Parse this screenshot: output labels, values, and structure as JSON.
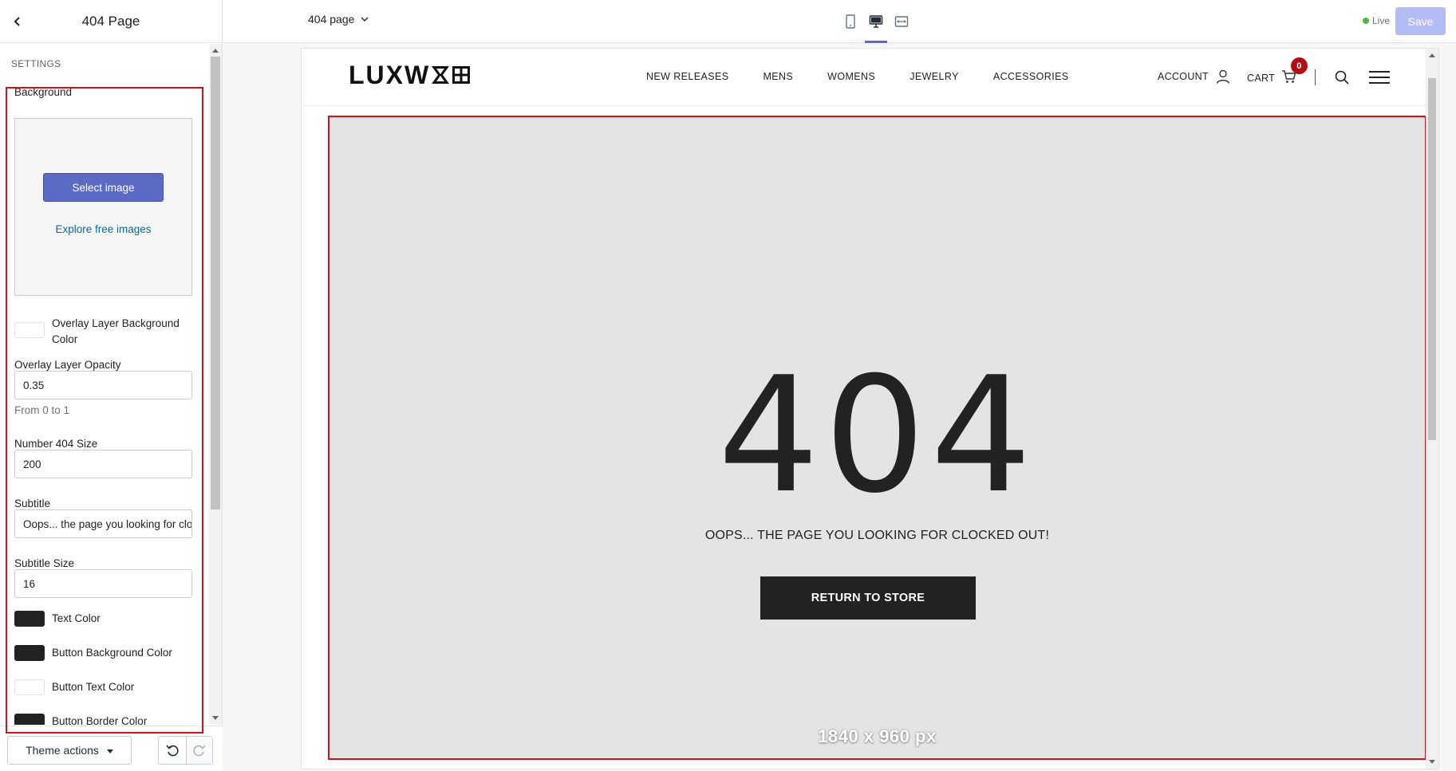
{
  "sidebar": {
    "title": "404 Page",
    "section_label": "SETTINGS",
    "background": {
      "label": "Background",
      "select_button": "Select image",
      "explore_link": "Explore free images"
    },
    "fields": {
      "overlay_color_label": "Overlay Layer Background Color",
      "overlay_color": "#ffffff",
      "opacity_label": "Overlay Layer Opacity",
      "opacity_value": "0.35",
      "opacity_hint": "From 0 to 1",
      "number_size_label": "Number 404 Size",
      "number_size_value": "200",
      "subtitle_label": "Subtitle",
      "subtitle_value": "Oops... the page you looking for clocked out!",
      "subtitle_size_label": "Subtitle Size",
      "subtitle_size_value": "16",
      "text_color_label": "Text Color",
      "text_color": "#222222",
      "button_bg_label": "Button Background Color",
      "button_bg": "#222222",
      "button_text_label": "Button Text Color",
      "button_text": "#ffffff",
      "button_border_label": "Button Border Color",
      "button_border": "#222222"
    },
    "footer": {
      "theme_actions": "Theme actions",
      "undo_icon": "undo-icon",
      "redo_icon": "redo-icon"
    }
  },
  "topbar": {
    "page_select": "404 page",
    "viewports": [
      "mobile-icon",
      "desktop-icon",
      "fullwidth-icon"
    ],
    "active_viewport": "desktop-icon",
    "live_label": "Live",
    "save_label": "Save"
  },
  "store": {
    "logo": "LUXW",
    "nav": [
      "NEW RELEASES",
      "MENS",
      "WOMENS",
      "JEWELRY",
      "ACCESSORIES"
    ],
    "account_label": "ACCOUNT",
    "cart_label": "CART",
    "cart_count": "0"
  },
  "error_page": {
    "number": "404",
    "subtitle": "OOPS... THE PAGE YOU LOOKING FOR CLOCKED OUT!",
    "button": "RETURN TO STORE",
    "dimensions_overlay": "1840 x 960 px"
  },
  "colors": {
    "accent": "#5c6ac4",
    "highlight": "#d4111b",
    "badge": "#b30e16",
    "section_bg": "#e4e4e4"
  }
}
